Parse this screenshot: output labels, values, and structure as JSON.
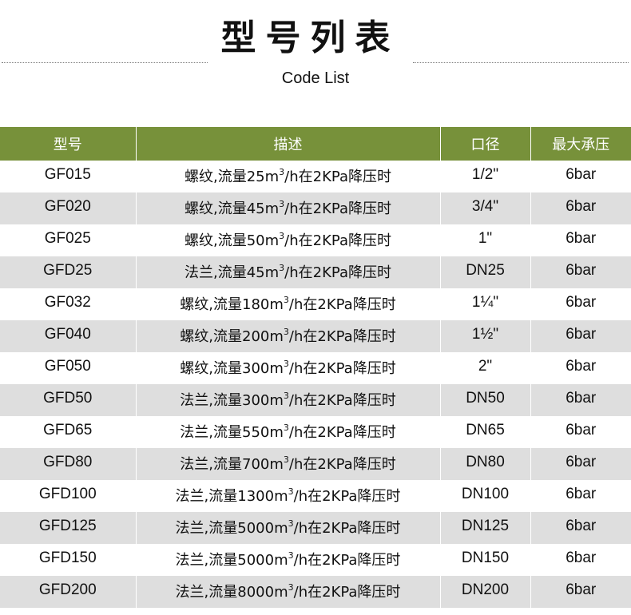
{
  "header": {
    "title": "型号列表",
    "subtitle": "Code List"
  },
  "table": {
    "columns": [
      "型号",
      "描述",
      "口径",
      "最大承压"
    ],
    "rows": [
      {
        "model": "GF015",
        "desc_pre": "螺纹,流量25m",
        "desc_sup": "3",
        "desc_post": "/h在2KPa降压时",
        "size": "1/2\"",
        "pressure": "6bar"
      },
      {
        "model": "GF020",
        "desc_pre": "螺纹,流量45m",
        "desc_sup": "3",
        "desc_post": "/h在2KPa降压时",
        "size": "3/4\"",
        "pressure": "6bar"
      },
      {
        "model": "GF025",
        "desc_pre": "螺纹,流量50m",
        "desc_sup": "3",
        "desc_post": "/h在2KPa降压时",
        "size": "1\"",
        "pressure": "6bar"
      },
      {
        "model": "GFD25",
        "desc_pre": "法兰,流量45m",
        "desc_sup": "3",
        "desc_post": "/h在2KPa降压时",
        "size": "DN25",
        "pressure": "6bar"
      },
      {
        "model": "GF032",
        "desc_pre": "螺纹,流量180m",
        "desc_sup": "3",
        "desc_post": "/h在2KPa降压时",
        "size": "1¼\"",
        "pressure": "6bar"
      },
      {
        "model": "GF040",
        "desc_pre": "螺纹,流量200m",
        "desc_sup": "3",
        "desc_post": "/h在2KPa降压时",
        "size": "1½\"",
        "pressure": "6bar"
      },
      {
        "model": "GF050",
        "desc_pre": "螺纹,流量300m",
        "desc_sup": "3",
        "desc_post": "/h在2KPa降压时",
        "size": "2\"",
        "pressure": "6bar"
      },
      {
        "model": "GFD50",
        "desc_pre": "法兰,流量300m",
        "desc_sup": "3",
        "desc_post": "/h在2KPa降压时",
        "size": "DN50",
        "pressure": "6bar"
      },
      {
        "model": "GFD65",
        "desc_pre": "法兰,流量550m",
        "desc_sup": "3",
        "desc_post": "/h在2KPa降压时",
        "size": "DN65",
        "pressure": "6bar"
      },
      {
        "model": "GFD80",
        "desc_pre": "法兰,流量700m",
        "desc_sup": "3",
        "desc_post": "/h在2KPa降压时",
        "size": "DN80",
        "pressure": "6bar"
      },
      {
        "model": "GFD100",
        "desc_pre": "法兰,流量1300m",
        "desc_sup": "3",
        "desc_post": "/h在2KPa降压时",
        "size": "DN100",
        "pressure": "6bar"
      },
      {
        "model": "GFD125",
        "desc_pre": "法兰,流量5000m",
        "desc_sup": "3",
        "desc_post": "/h在2KPa降压时",
        "size": "DN125",
        "pressure": "6bar"
      },
      {
        "model": "GFD150",
        "desc_pre": "法兰,流量5000m",
        "desc_sup": "3",
        "desc_post": "/h在2KPa降压时",
        "size": "DN150",
        "pressure": "6bar"
      },
      {
        "model": "GFD200",
        "desc_pre": "法兰,流量8000m",
        "desc_sup": "3",
        "desc_post": "/h在2KPa降压时",
        "size": "DN200",
        "pressure": "6bar"
      }
    ]
  },
  "colors": {
    "header_bg": "#77913a",
    "stripe_bg": "#dedede"
  }
}
